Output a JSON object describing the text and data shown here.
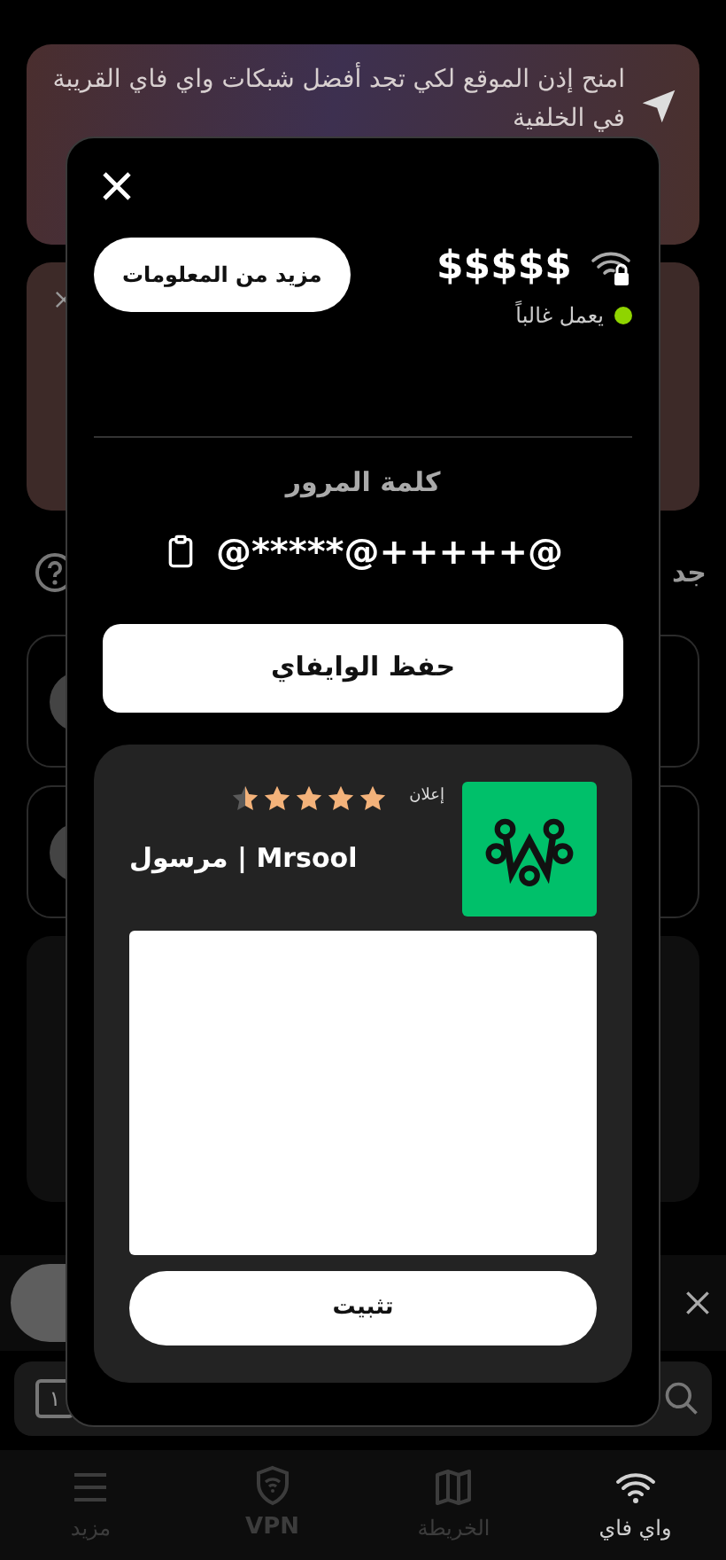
{
  "banner": {
    "text": "امنح إذن الموقع لكي تجد أفضل شبكات واي فاي القريبة في الخلفية"
  },
  "section": {
    "heading": "جد"
  },
  "search": {
    "badge": "١"
  },
  "modal": {
    "network_name": "$$$$$",
    "status": {
      "text": "يعمل غالباً",
      "color": "#8fd400"
    },
    "more_info_button": "مزيد من المعلومات",
    "password_label": "كلمة المرور",
    "password": "@*****@+++++@",
    "save_button": "حفظ الوايفاي",
    "ad": {
      "badge": "إعلان",
      "stars": 4.5,
      "app_name": "مرسول | Mrsool",
      "install_button": "تثبيت"
    }
  },
  "nav": [
    {
      "label": "واي فاي",
      "selected": true
    },
    {
      "label": "الخريطة",
      "selected": false
    },
    {
      "label": "VPN",
      "selected": false
    },
    {
      "label": "مزيد",
      "selected": false
    }
  ]
}
